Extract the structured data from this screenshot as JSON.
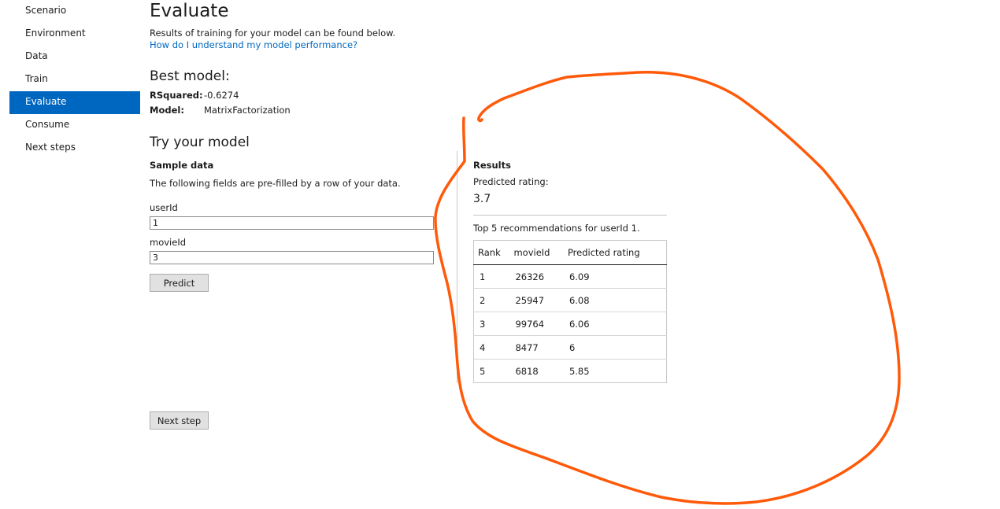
{
  "sidebar": {
    "items": [
      {
        "label": "Scenario"
      },
      {
        "label": "Environment"
      },
      {
        "label": "Data"
      },
      {
        "label": "Train"
      },
      {
        "label": "Evaluate"
      },
      {
        "label": "Consume"
      },
      {
        "label": "Next steps"
      }
    ],
    "active": "Evaluate",
    "active_color": "#0067c0"
  },
  "header": {
    "title": "Evaluate",
    "description": "Results of training for your model can be found below.",
    "help_link": "How do I understand my model performance?"
  },
  "best_model": {
    "title": "Best model:",
    "rsquared_label": "RSquared:",
    "rsquared_value": "-0.6274",
    "model_label": "Model:",
    "model_value": "MatrixFactorization"
  },
  "try_model": {
    "title": "Try your model",
    "sample_title": "Sample data",
    "sample_desc": "The following fields are pre-filled by a row of your data.",
    "userid_label": "userId",
    "userid_value": "1",
    "movieid_label": "movieId",
    "movieid_value": "3",
    "predict_label": "Predict"
  },
  "results": {
    "title": "Results",
    "predicted_label": "Predicted rating:",
    "predicted_value": "3.7",
    "top_label": "Top 5 recommendations for userId 1.",
    "columns": [
      "Rank",
      "movieId",
      "Predicted rating"
    ],
    "rows": [
      [
        "1",
        "26326",
        "6.09"
      ],
      [
        "2",
        "25947",
        "6.08"
      ],
      [
        "3",
        "99764",
        "6.06"
      ],
      [
        "4",
        "8477",
        "6"
      ],
      [
        "5",
        "6818",
        "5.85"
      ]
    ]
  },
  "footer": {
    "next_label": "Next step"
  },
  "annotation": {
    "color": "#ff5a0a"
  }
}
